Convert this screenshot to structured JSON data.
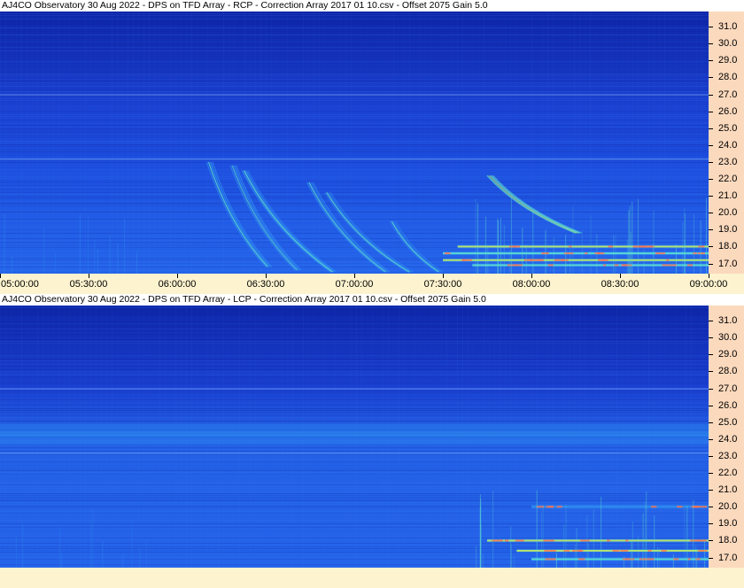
{
  "chart_data": [
    {
      "type": "heatmap",
      "title": "AJ4CO Observatory 30 Aug 2022  -  DPS on TFD Array  -  RCP  -  Correction Array 2017 01 10.csv  -  Offset 2075  Gain 5.0",
      "xlabel": "",
      "ylabel": "",
      "x_ticks": [
        "05:00:00",
        "05:30:00",
        "06:00:00",
        "06:30:00",
        "07:00:00",
        "07:30:00",
        "08:00:00",
        "08:30:00",
        "09:00:00"
      ],
      "y_ticks": [
        "17.0",
        "18.0",
        "19.0",
        "20.0",
        "21.0",
        "22.0",
        "23.0",
        "24.0",
        "25.0",
        "26.0",
        "27.0",
        "28.0",
        "29.0",
        "30.0",
        "31.0"
      ],
      "ylim": [
        16.4,
        31.9
      ],
      "xlim_minutes": [
        0,
        240
      ],
      "palette": [
        "#1330c0",
        "#1f5ae8",
        "#2f8ef0",
        "#5fe0d0",
        "#c8f060",
        "#ff7050"
      ],
      "features": [
        {
          "kind": "arc",
          "t_start_min": 70,
          "t_end_min": 90,
          "f_start": 23.0,
          "f_end": 16.8,
          "level": 2
        },
        {
          "kind": "arc",
          "t_start_min": 78,
          "t_end_min": 100,
          "f_start": 22.8,
          "f_end": 16.6,
          "level": 2
        },
        {
          "kind": "arc",
          "t_start_min": 82,
          "t_end_min": 112,
          "f_start": 22.5,
          "f_end": 16.5,
          "level": 2
        },
        {
          "kind": "arc",
          "t_start_min": 104,
          "t_end_min": 130,
          "f_start": 21.8,
          "f_end": 16.5,
          "level": 2
        },
        {
          "kind": "arc",
          "t_start_min": 110,
          "t_end_min": 138,
          "f_start": 21.2,
          "f_end": 16.5,
          "level": 2
        },
        {
          "kind": "arc",
          "t_start_min": 132,
          "t_end_min": 148,
          "f_start": 19.5,
          "f_end": 16.5,
          "level": 2
        },
        {
          "kind": "arc",
          "t_start_min": 165,
          "t_end_min": 195,
          "f_start": 22.2,
          "f_end": 18.8,
          "level": 3
        },
        {
          "kind": "band",
          "t_start_min": 155,
          "t_end_min": 240,
          "f": 18.0,
          "level": 4
        },
        {
          "kind": "band",
          "t_start_min": 150,
          "t_end_min": 240,
          "f": 17.6,
          "level": 3
        },
        {
          "kind": "band",
          "t_start_min": 150,
          "t_end_min": 240,
          "f": 17.2,
          "level": 4
        },
        {
          "kind": "band",
          "t_start_min": 160,
          "t_end_min": 240,
          "f": 16.9,
          "level": 3
        }
      ]
    },
    {
      "type": "heatmap",
      "title": "AJ4CO Observatory 30 Aug 2022  -  DPS on TFD Array  -  LCP  -  Correction Array 2017 01 10.csv  -  Offset 2075  Gain 5.0",
      "xlabel": "",
      "ylabel": "",
      "x_ticks": [],
      "y_ticks": [
        "17.0",
        "18.0",
        "19.0",
        "20.0",
        "21.0",
        "22.0",
        "23.0",
        "24.0",
        "25.0",
        "26.0",
        "27.0",
        "28.0",
        "29.0",
        "30.0",
        "31.0"
      ],
      "ylim": [
        16.4,
        31.9
      ],
      "xlim_minutes": [
        0,
        240
      ],
      "palette": [
        "#1330c0",
        "#1f5ae8",
        "#2f8ef0",
        "#5fe0d0",
        "#c8f060",
        "#ff7050"
      ],
      "features": [
        {
          "kind": "glow",
          "f_center": 24.3,
          "f_width": 1.2,
          "level": 2
        },
        {
          "kind": "band",
          "t_start_min": 180,
          "t_end_min": 240,
          "f": 20.0,
          "level": 2
        },
        {
          "kind": "band",
          "t_start_min": 165,
          "t_end_min": 240,
          "f": 18.0,
          "level": 4
        },
        {
          "kind": "band",
          "t_start_min": 175,
          "t_end_min": 240,
          "f": 17.4,
          "level": 4
        },
        {
          "kind": "band",
          "t_start_min": 180,
          "t_end_min": 240,
          "f": 16.9,
          "level": 3
        }
      ]
    }
  ]
}
